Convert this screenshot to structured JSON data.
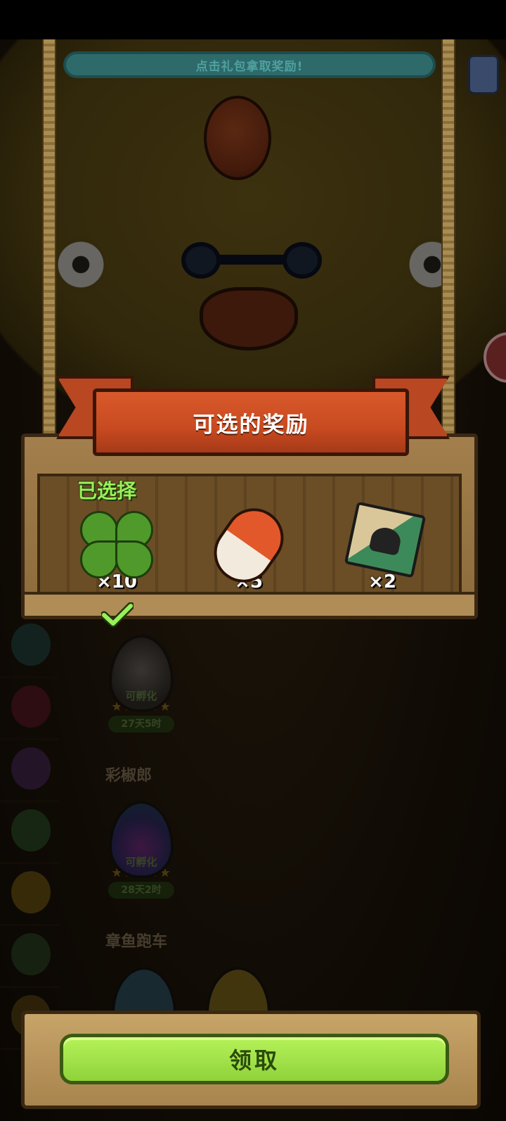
{
  "hint": {
    "text": "点击礼包拿取奖励!"
  },
  "reward_panel": {
    "title": "可选的奖励",
    "selected_label": "已选择",
    "rewards": [
      {
        "name": "clover-icon",
        "quantity": "×10",
        "selected": true
      },
      {
        "name": "capsule-icon",
        "quantity": "×5",
        "selected": false
      },
      {
        "name": "card-icon",
        "quantity": "×2",
        "selected": false
      }
    ]
  },
  "background": {
    "eggs": [
      {
        "hatch_label": "可孵化",
        "stars": "★★★★★",
        "timer": "27天5时"
      },
      {
        "hatch_label": "可孵化",
        "stars": "★★★★★",
        "timer": "28天2时"
      }
    ],
    "section_names": [
      "彩椒郎",
      "章鱼跑车"
    ]
  },
  "claim_button": {
    "label": "领取"
  },
  "colors": {
    "accent_green": "#9bef5a",
    "ribbon_red": "#c84a20",
    "wood": "#a27f4c"
  }
}
